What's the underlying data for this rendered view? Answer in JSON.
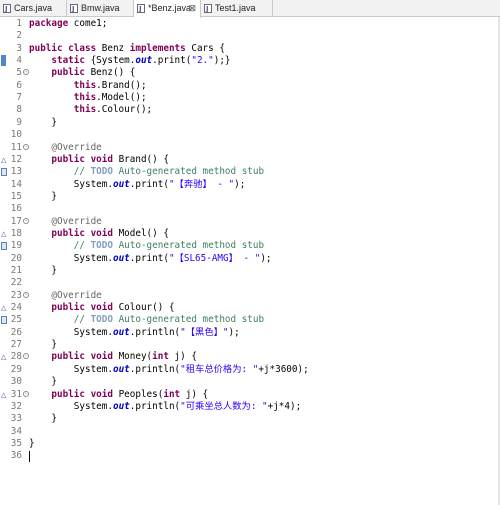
{
  "tabs": [
    {
      "label": "Cars.java",
      "close": "",
      "active": false
    },
    {
      "label": "Bmw.java",
      "close": "",
      "active": false
    },
    {
      "label": "*Benz.java",
      "close": "⊠",
      "active": true
    },
    {
      "label": "Test1.java",
      "close": "",
      "active": false
    }
  ],
  "icons": {
    "file": "java-file-icon",
    "fold": "fold-toggle-icon",
    "override": "override-triangle-icon",
    "task": "task-marker-icon"
  },
  "colors": {
    "keyword": "#7f0055",
    "string": "#2a00ff",
    "comment": "#3f7f5f",
    "field": "#0000c0",
    "annotation": "#646464"
  },
  "editor": {
    "lines": [
      {
        "n": "1",
        "marker": "",
        "fold": "",
        "segments": [
          [
            "kw",
            "package"
          ],
          [
            "t",
            " come1;"
          ]
        ]
      },
      {
        "n": "2",
        "marker": "",
        "fold": "",
        "segments": []
      },
      {
        "n": "3",
        "marker": "",
        "fold": "",
        "segments": [
          [
            "kw",
            "public class"
          ],
          [
            "t",
            " Benz "
          ],
          [
            "kw",
            "implements"
          ],
          [
            "t",
            " Cars {"
          ]
        ]
      },
      {
        "n": "4",
        "marker": "bar",
        "fold": "",
        "segments": [
          [
            "t",
            "    "
          ],
          [
            "kw",
            "static"
          ],
          [
            "t",
            " {System."
          ],
          [
            "fld",
            "out"
          ],
          [
            "t",
            ".print("
          ],
          [
            "str",
            "\"2.\""
          ],
          [
            "t",
            ");}"
          ]
        ]
      },
      {
        "n": "5",
        "marker": "",
        "fold": "⊖",
        "segments": [
          [
            "t",
            "    "
          ],
          [
            "kw",
            "public"
          ],
          [
            "t",
            " Benz() {"
          ]
        ]
      },
      {
        "n": "6",
        "marker": "",
        "fold": "",
        "segments": [
          [
            "t",
            "        "
          ],
          [
            "kw",
            "this"
          ],
          [
            "t",
            ".Brand();"
          ]
        ]
      },
      {
        "n": "7",
        "marker": "",
        "fold": "",
        "segments": [
          [
            "t",
            "        "
          ],
          [
            "kw",
            "this"
          ],
          [
            "t",
            ".Model();"
          ]
        ]
      },
      {
        "n": "8",
        "marker": "",
        "fold": "",
        "segments": [
          [
            "t",
            "        "
          ],
          [
            "kw",
            "this"
          ],
          [
            "t",
            ".Colour();"
          ]
        ]
      },
      {
        "n": "9",
        "marker": "",
        "fold": "",
        "segments": [
          [
            "t",
            "    }"
          ]
        ]
      },
      {
        "n": "10",
        "marker": "",
        "fold": "",
        "segments": []
      },
      {
        "n": "11",
        "marker": "",
        "fold": "⊖",
        "segments": [
          [
            "t",
            "    "
          ],
          [
            "ann",
            "@Override"
          ]
        ]
      },
      {
        "n": "12",
        "marker": "tri",
        "fold": "",
        "segments": [
          [
            "t",
            "    "
          ],
          [
            "kw",
            "public void"
          ],
          [
            "t",
            " Brand() {"
          ]
        ]
      },
      {
        "n": "13",
        "marker": "task",
        "fold": "",
        "segments": [
          [
            "t",
            "        "
          ],
          [
            "cmt",
            "// "
          ],
          [
            "todo",
            "TODO"
          ],
          [
            "cmt",
            " Auto-generated method stub"
          ]
        ]
      },
      {
        "n": "14",
        "marker": "",
        "fold": "",
        "segments": [
          [
            "t",
            "        System."
          ],
          [
            "fld",
            "out"
          ],
          [
            "t",
            ".print("
          ],
          [
            "str",
            "\"【奔驰】 - \""
          ],
          [
            "t",
            ");"
          ]
        ]
      },
      {
        "n": "15",
        "marker": "",
        "fold": "",
        "segments": [
          [
            "t",
            "    }"
          ]
        ]
      },
      {
        "n": "16",
        "marker": "",
        "fold": "",
        "segments": []
      },
      {
        "n": "17",
        "marker": "",
        "fold": "⊖",
        "segments": [
          [
            "t",
            "    "
          ],
          [
            "ann",
            "@Override"
          ]
        ]
      },
      {
        "n": "18",
        "marker": "tri",
        "fold": "",
        "segments": [
          [
            "t",
            "    "
          ],
          [
            "kw",
            "public void"
          ],
          [
            "t",
            " Model() {"
          ]
        ]
      },
      {
        "n": "19",
        "marker": "task",
        "fold": "",
        "segments": [
          [
            "t",
            "        "
          ],
          [
            "cmt",
            "// "
          ],
          [
            "todo",
            "TODO"
          ],
          [
            "cmt",
            " Auto-generated method stub"
          ]
        ]
      },
      {
        "n": "20",
        "marker": "",
        "fold": "",
        "segments": [
          [
            "t",
            "        System."
          ],
          [
            "fld",
            "out"
          ],
          [
            "t",
            ".print("
          ],
          [
            "str",
            "\"【SL65-AMG】 - \""
          ],
          [
            "t",
            ");"
          ]
        ]
      },
      {
        "n": "21",
        "marker": "",
        "fold": "",
        "segments": [
          [
            "t",
            "    }"
          ]
        ]
      },
      {
        "n": "22",
        "marker": "",
        "fold": "",
        "segments": []
      },
      {
        "n": "23",
        "marker": "",
        "fold": "⊖",
        "segments": [
          [
            "t",
            "    "
          ],
          [
            "ann",
            "@Override"
          ]
        ]
      },
      {
        "n": "24",
        "marker": "tri",
        "fold": "",
        "segments": [
          [
            "t",
            "    "
          ],
          [
            "kw",
            "public void"
          ],
          [
            "t",
            " Colour() {"
          ]
        ]
      },
      {
        "n": "25",
        "marker": "task",
        "fold": "",
        "segments": [
          [
            "t",
            "        "
          ],
          [
            "cmt",
            "// "
          ],
          [
            "todo",
            "TODO"
          ],
          [
            "cmt",
            " Auto-generated method stub"
          ]
        ]
      },
      {
        "n": "26",
        "marker": "",
        "fold": "",
        "segments": [
          [
            "t",
            "        System."
          ],
          [
            "fld",
            "out"
          ],
          [
            "t",
            ".println("
          ],
          [
            "str",
            "\"【黑色】\""
          ],
          [
            "t",
            ");"
          ]
        ]
      },
      {
        "n": "27",
        "marker": "",
        "fold": "",
        "segments": [
          [
            "t",
            "    }"
          ]
        ]
      },
      {
        "n": "28",
        "marker": "tri",
        "fold": "⊖",
        "segments": [
          [
            "t",
            "    "
          ],
          [
            "kw",
            "public void"
          ],
          [
            "t",
            " Money("
          ],
          [
            "kw",
            "int"
          ],
          [
            "t",
            " j) {"
          ]
        ]
      },
      {
        "n": "29",
        "marker": "",
        "fold": "",
        "segments": [
          [
            "t",
            "        System."
          ],
          [
            "fld",
            "out"
          ],
          [
            "t",
            ".println("
          ],
          [
            "str",
            "\"租车总价格为: \""
          ],
          [
            "t",
            "+j*3600);"
          ]
        ]
      },
      {
        "n": "30",
        "marker": "",
        "fold": "",
        "segments": [
          [
            "t",
            "    }"
          ]
        ]
      },
      {
        "n": "31",
        "marker": "tri",
        "fold": "⊖",
        "segments": [
          [
            "t",
            "    "
          ],
          [
            "kw",
            "public void"
          ],
          [
            "t",
            " Peoples("
          ],
          [
            "kw",
            "int"
          ],
          [
            "t",
            " j) {"
          ]
        ]
      },
      {
        "n": "32",
        "marker": "",
        "fold": "",
        "segments": [
          [
            "t",
            "        System."
          ],
          [
            "fld",
            "out"
          ],
          [
            "t",
            ".println("
          ],
          [
            "str",
            "\"可乘坐总人数为: \""
          ],
          [
            "t",
            "+j*4);"
          ]
        ]
      },
      {
        "n": "33",
        "marker": "",
        "fold": "",
        "segments": [
          [
            "t",
            "    }"
          ]
        ]
      },
      {
        "n": "34",
        "marker": "",
        "fold": "",
        "segments": []
      },
      {
        "n": "35",
        "marker": "",
        "fold": "",
        "segments": [
          [
            "t",
            "}"
          ]
        ]
      },
      {
        "n": "36",
        "marker": "",
        "fold": "",
        "segments": []
      }
    ]
  }
}
